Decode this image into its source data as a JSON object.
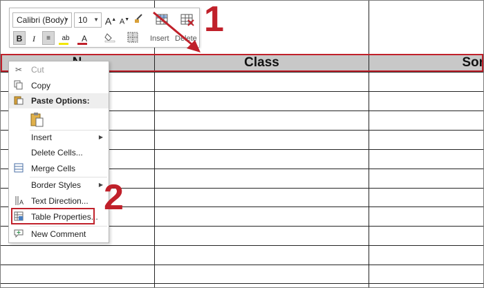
{
  "toolbar": {
    "font_name": "Calibri (Body)",
    "font_size": "10",
    "grow_font": "A",
    "shrink_font": "A",
    "bold": "B",
    "italic": "I",
    "highlight": "ab",
    "font_color": "A",
    "insert_label": "Insert",
    "delete_label": "Delete"
  },
  "table": {
    "headers": [
      "N",
      "Class",
      "Sor"
    ]
  },
  "context_menu": {
    "items": [
      {
        "label": "Cut",
        "icon": "scissors-icon",
        "disabled": true
      },
      {
        "label": "Copy",
        "icon": "copy-icon",
        "disabled": false
      },
      {
        "label": "Paste Options:",
        "icon": "paste-icon",
        "heading": true
      },
      {
        "label": "",
        "icon": "paste-keep-source-icon"
      },
      {
        "label": "Insert",
        "submenu": true
      },
      {
        "label": "Delete Cells...",
        "disabled": false
      },
      {
        "label": "Merge Cells",
        "icon": "merge-cells-icon",
        "disabled": false
      },
      {
        "label": "Border Styles",
        "submenu": true
      },
      {
        "label": "Text Direction...",
        "icon": "text-direction-icon"
      },
      {
        "label": "Table Properties...",
        "icon": "table-properties-icon"
      },
      {
        "label": "New Comment",
        "icon": "new-comment-icon"
      }
    ]
  },
  "annotations": {
    "step1": "1",
    "step2": "2"
  },
  "colors": {
    "accent": "#c0202a",
    "header_fill": "#c8c8c8"
  }
}
